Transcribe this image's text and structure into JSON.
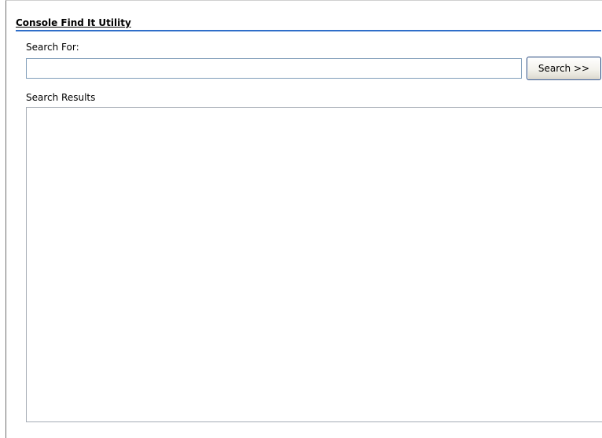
{
  "panel": {
    "title": "Console Find It Utility"
  },
  "search": {
    "label": "Search For:",
    "value": "",
    "placeholder": "",
    "button_label": "Search >>"
  },
  "results": {
    "label": "Search Results",
    "items": []
  },
  "colors": {
    "title_underline": "#2f6ec9",
    "input_border": "#7f9db9",
    "button_border": "#24467c",
    "results_border": "#a5acb5"
  }
}
